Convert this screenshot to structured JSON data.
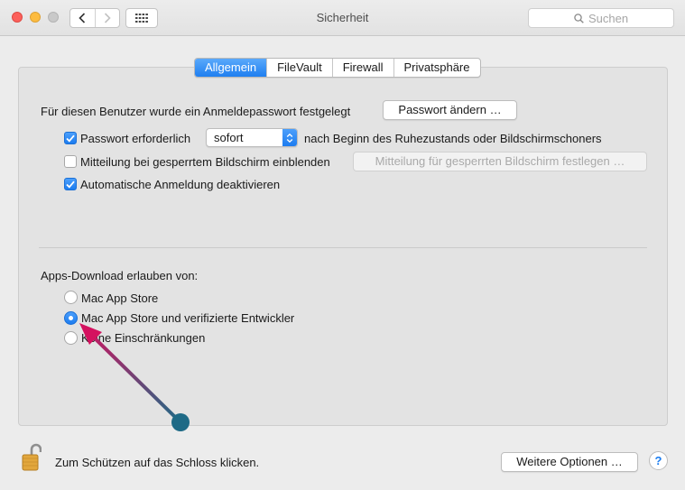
{
  "window": {
    "title": "Sicherheit",
    "search_placeholder": "Suchen"
  },
  "tabs": [
    {
      "label": "Allgemein",
      "active": true
    },
    {
      "label": "FileVault",
      "active": false
    },
    {
      "label": "Firewall",
      "active": false
    },
    {
      "label": "Privatsphäre",
      "active": false
    }
  ],
  "general": {
    "password_set_text": "Für diesen Benutzer wurde ein Anmeldepasswort festgelegt",
    "change_password_button": "Passwort ändern …",
    "require_password": {
      "checked": true,
      "label": "Passwort erforderlich",
      "select_value": "sofort",
      "suffix": "nach Beginn des Ruhezustands oder Bildschirmschoners"
    },
    "lock_message": {
      "checked": false,
      "label": "Mitteilung bei gesperrtem Bildschirm einblenden",
      "button": "Mitteilung für gesperrten Bildschirm festlegen …"
    },
    "auto_login": {
      "checked": true,
      "label": "Automatische Anmeldung deaktivieren"
    }
  },
  "downloads": {
    "heading": "Apps-Download erlauben von:",
    "options": [
      {
        "label": "Mac App Store",
        "selected": false
      },
      {
        "label": "Mac App Store und verifizierte Entwickler",
        "selected": true
      },
      {
        "label": "Keine Einschränkungen",
        "selected": false
      }
    ]
  },
  "footer": {
    "lock_text": "Zum Schützen auf das Schloss klicken.",
    "more_options_button": "Weitere Optionen …",
    "help_label": "?"
  },
  "colors": {
    "accent_blue": "#1f7ff0",
    "annotation_arrow_start": "#1e6a86",
    "annotation_arrow_end": "#d4125f"
  },
  "icons": [
    "back-icon",
    "forward-icon",
    "grid-icon",
    "search-icon",
    "checkmark-icon",
    "chevron-updown-icon",
    "padlock-icon",
    "annotation-arrow"
  ]
}
